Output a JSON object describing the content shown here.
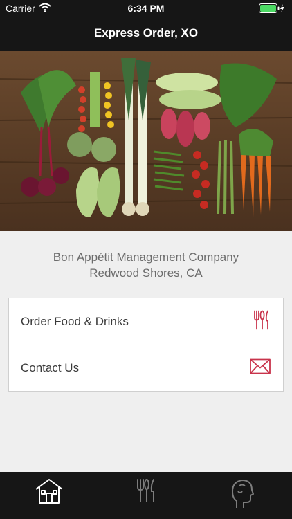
{
  "status_bar": {
    "carrier": "Carrier",
    "time": "6:34 PM",
    "battery_icon": "battery-charging-icon",
    "wifi_icon": "wifi-icon"
  },
  "nav": {
    "title": "Express Order, XO"
  },
  "hero": {
    "image": "vegetables-on-wood-table"
  },
  "company": {
    "name": "Bon Appétit Management Company",
    "location": "Redwood Shores, CA"
  },
  "menu": {
    "items": [
      {
        "label": "Order Food & Drinks",
        "icon": "fork-knife-icon"
      },
      {
        "label": "Contact Us",
        "icon": "envelope-icon"
      }
    ]
  },
  "tab_bar": {
    "tabs": [
      {
        "icon": "home-icon",
        "active": true
      },
      {
        "icon": "fork-knife-icon",
        "active": false
      },
      {
        "icon": "profile-icon",
        "active": false
      }
    ]
  },
  "colors": {
    "bar_bg": "#161616",
    "accent": "#c8334b",
    "page_bg": "#efefef",
    "battery": "#4cd964"
  }
}
